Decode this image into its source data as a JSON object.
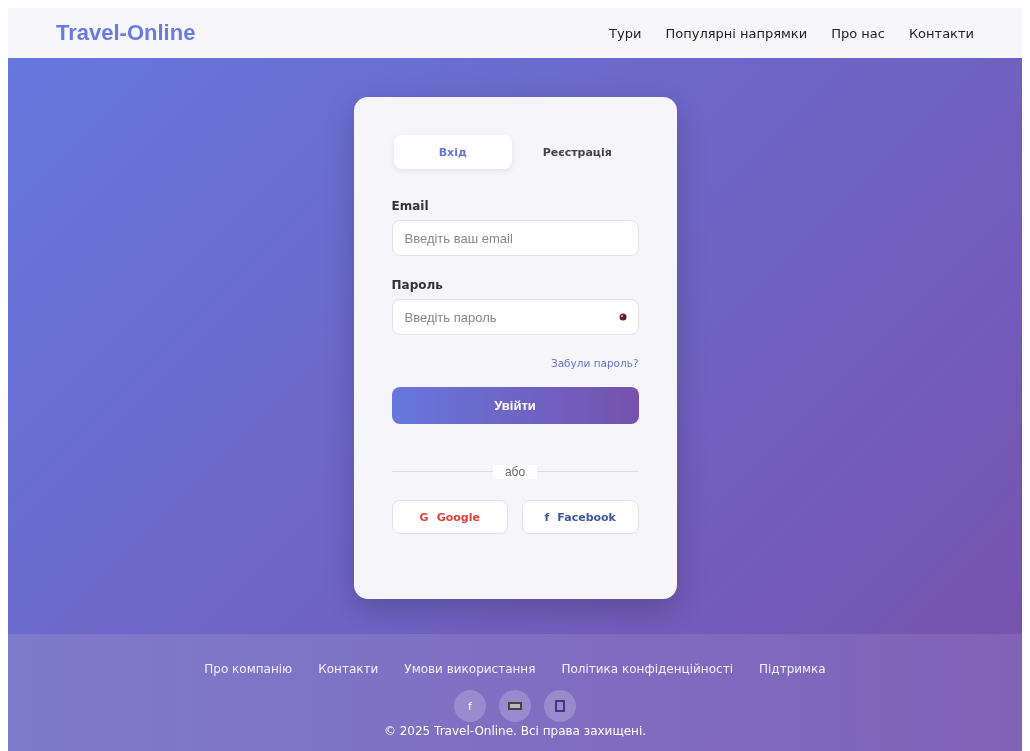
{
  "header": {
    "logo": "Travel-Online",
    "nav": [
      "Тури",
      "Популярні напрямки",
      "Про нас",
      "Контакти"
    ]
  },
  "login": {
    "tabs": [
      {
        "label": "Вхід",
        "selected": true
      },
      {
        "label": "Реєстрація",
        "selected": false
      }
    ],
    "fields": [
      {
        "label": "Email",
        "placeholder": "Введіть ваш email",
        "kind": "text"
      },
      {
        "label": "Пароль",
        "placeholder": "Введіть пароль",
        "kind": "password"
      }
    ],
    "forgot": "Забули пароль?",
    "submit": "Увійти",
    "divider": "або",
    "social": [
      {
        "glyph": "G",
        "label": "Google",
        "color": "#db4437"
      },
      {
        "glyph": "f",
        "label": "Facebook",
        "color": "#3b5998"
      }
    ]
  },
  "footer": {
    "links": [
      "Про компанію",
      "Контакти",
      "Умови використання",
      "Політика конфіденційності",
      "Підтримка"
    ],
    "social": [
      {
        "kind": "text",
        "glyph": "f"
      },
      {
        "kind": "card"
      },
      {
        "kind": "grid"
      }
    ],
    "copyright": "© 2025 Travel-Online. Всі права захищені."
  }
}
